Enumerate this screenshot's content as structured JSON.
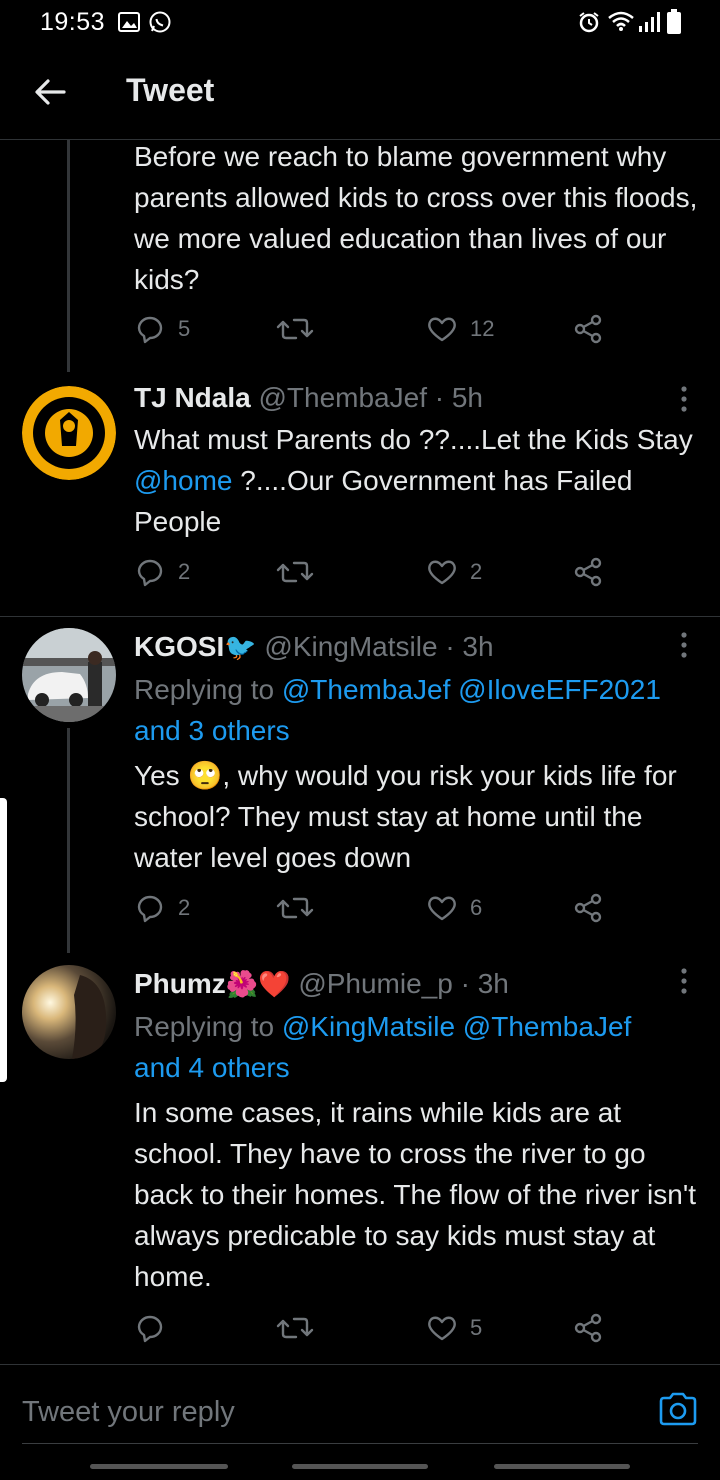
{
  "status_bar": {
    "time": "19:53"
  },
  "header": {
    "title": "Tweet"
  },
  "parent_tweet": {
    "text": "Before we reach to blame government why parents allowed kids to cross over this floods, we more valued education than lives of our kids?",
    "replies": "5",
    "retweets": "",
    "likes": "12"
  },
  "tweets": [
    {
      "name": "TJ Ndala",
      "handle": "@ThembaJef · 5h",
      "text_before": "What must Parents do ??....Let the Kids Stay ",
      "text_link": "@home",
      "text_after": " ?....Our Government has Failed People",
      "replies": "2",
      "likes": "2"
    },
    {
      "name": "KGOSI",
      "name_emoji": "🐦",
      "handle": "@KingMatsile · 3h",
      "replying_label": "Replying to ",
      "replying_links": "@ThembaJef @IloveEFF2021",
      "replying_others": "and 3 others",
      "text_before": "Yes ",
      "text_emoji": "🙄",
      "text_after": ", why would you risk your kids life for school? They must stay at home until the water level goes down",
      "replies": "2",
      "likes": "6"
    },
    {
      "name": "Phumz",
      "name_emoji": "🌺❤️",
      "handle": "@Phumie_p · 3h",
      "replying_label": "Replying to ",
      "replying_links": "@KingMatsile @ThembaJef",
      "replying_others": "and 4 others",
      "text": "In some cases, it rains while kids are at school. They have to cross the river to go back to their homes. The flow of the river isn't always predicable to say kids must stay at home.",
      "replies": "",
      "likes": "5"
    }
  ],
  "composer": {
    "placeholder": "Tweet your reply"
  },
  "colors": {
    "background": "#000000",
    "text": "#e7e9ea",
    "muted": "#71767b",
    "link": "#1d9bf0",
    "divider": "#2f3336"
  },
  "icons": [
    "gallery-icon",
    "whatsapp-icon",
    "alarm-icon",
    "wifi-icon",
    "signal-icon",
    "battery-icon",
    "back-arrow-icon",
    "reply-icon",
    "retweet-icon",
    "like-icon",
    "share-icon",
    "more-icon",
    "camera-icon"
  ]
}
